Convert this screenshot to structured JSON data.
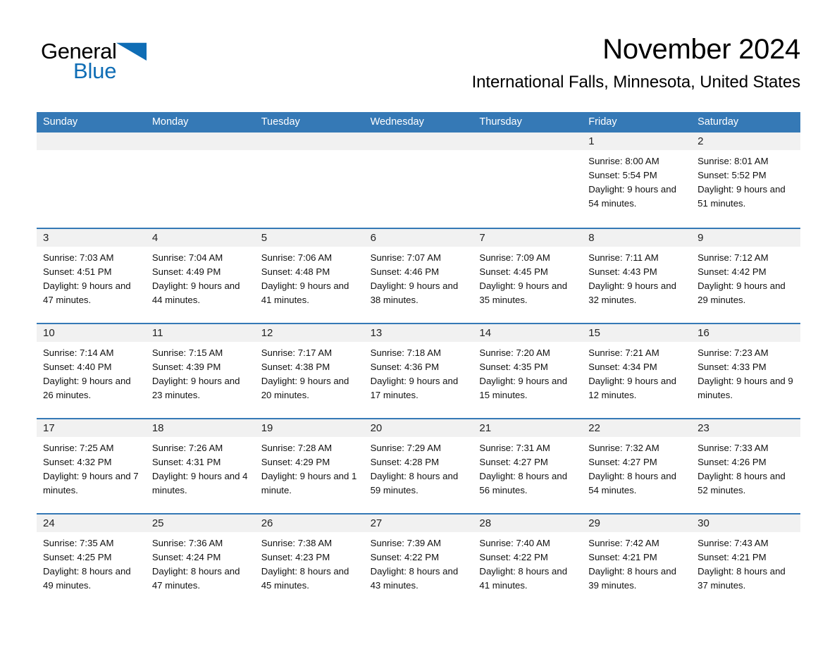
{
  "brand": {
    "name_part_1": "General",
    "name_part_2": "Blue",
    "triangle_color": "#0f6db5",
    "blue_text_color": "#0f6db5"
  },
  "header": {
    "month_title": "November 2024",
    "location": "International Falls, Minnesota, United States"
  },
  "colors": {
    "header_blue": "#3579b6",
    "row_divider_blue": "#3579b6",
    "day_band_gray": "#f1f1f1",
    "text_black": "#000000"
  },
  "weekdays": [
    "Sunday",
    "Monday",
    "Tuesday",
    "Wednesday",
    "Thursday",
    "Friday",
    "Saturday"
  ],
  "weeks": [
    [
      {
        "day": "",
        "sunrise": "",
        "sunset": "",
        "daylight": ""
      },
      {
        "day": "",
        "sunrise": "",
        "sunset": "",
        "daylight": ""
      },
      {
        "day": "",
        "sunrise": "",
        "sunset": "",
        "daylight": ""
      },
      {
        "day": "",
        "sunrise": "",
        "sunset": "",
        "daylight": ""
      },
      {
        "day": "",
        "sunrise": "",
        "sunset": "",
        "daylight": ""
      },
      {
        "day": "1",
        "sunrise": "Sunrise: 8:00 AM",
        "sunset": "Sunset: 5:54 PM",
        "daylight": "Daylight: 9 hours and 54 minutes."
      },
      {
        "day": "2",
        "sunrise": "Sunrise: 8:01 AM",
        "sunset": "Sunset: 5:52 PM",
        "daylight": "Daylight: 9 hours and 51 minutes."
      }
    ],
    [
      {
        "day": "3",
        "sunrise": "Sunrise: 7:03 AM",
        "sunset": "Sunset: 4:51 PM",
        "daylight": "Daylight: 9 hours and 47 minutes."
      },
      {
        "day": "4",
        "sunrise": "Sunrise: 7:04 AM",
        "sunset": "Sunset: 4:49 PM",
        "daylight": "Daylight: 9 hours and 44 minutes."
      },
      {
        "day": "5",
        "sunrise": "Sunrise: 7:06 AM",
        "sunset": "Sunset: 4:48 PM",
        "daylight": "Daylight: 9 hours and 41 minutes."
      },
      {
        "day": "6",
        "sunrise": "Sunrise: 7:07 AM",
        "sunset": "Sunset: 4:46 PM",
        "daylight": "Daylight: 9 hours and 38 minutes."
      },
      {
        "day": "7",
        "sunrise": "Sunrise: 7:09 AM",
        "sunset": "Sunset: 4:45 PM",
        "daylight": "Daylight: 9 hours and 35 minutes."
      },
      {
        "day": "8",
        "sunrise": "Sunrise: 7:11 AM",
        "sunset": "Sunset: 4:43 PM",
        "daylight": "Daylight: 9 hours and 32 minutes."
      },
      {
        "day": "9",
        "sunrise": "Sunrise: 7:12 AM",
        "sunset": "Sunset: 4:42 PM",
        "daylight": "Daylight: 9 hours and 29 minutes."
      }
    ],
    [
      {
        "day": "10",
        "sunrise": "Sunrise: 7:14 AM",
        "sunset": "Sunset: 4:40 PM",
        "daylight": "Daylight: 9 hours and 26 minutes."
      },
      {
        "day": "11",
        "sunrise": "Sunrise: 7:15 AM",
        "sunset": "Sunset: 4:39 PM",
        "daylight": "Daylight: 9 hours and 23 minutes."
      },
      {
        "day": "12",
        "sunrise": "Sunrise: 7:17 AM",
        "sunset": "Sunset: 4:38 PM",
        "daylight": "Daylight: 9 hours and 20 minutes."
      },
      {
        "day": "13",
        "sunrise": "Sunrise: 7:18 AM",
        "sunset": "Sunset: 4:36 PM",
        "daylight": "Daylight: 9 hours and 17 minutes."
      },
      {
        "day": "14",
        "sunrise": "Sunrise: 7:20 AM",
        "sunset": "Sunset: 4:35 PM",
        "daylight": "Daylight: 9 hours and 15 minutes."
      },
      {
        "day": "15",
        "sunrise": "Sunrise: 7:21 AM",
        "sunset": "Sunset: 4:34 PM",
        "daylight": "Daylight: 9 hours and 12 minutes."
      },
      {
        "day": "16",
        "sunrise": "Sunrise: 7:23 AM",
        "sunset": "Sunset: 4:33 PM",
        "daylight": "Daylight: 9 hours and 9 minutes."
      }
    ],
    [
      {
        "day": "17",
        "sunrise": "Sunrise: 7:25 AM",
        "sunset": "Sunset: 4:32 PM",
        "daylight": "Daylight: 9 hours and 7 minutes."
      },
      {
        "day": "18",
        "sunrise": "Sunrise: 7:26 AM",
        "sunset": "Sunset: 4:31 PM",
        "daylight": "Daylight: 9 hours and 4 minutes."
      },
      {
        "day": "19",
        "sunrise": "Sunrise: 7:28 AM",
        "sunset": "Sunset: 4:29 PM",
        "daylight": "Daylight: 9 hours and 1 minute."
      },
      {
        "day": "20",
        "sunrise": "Sunrise: 7:29 AM",
        "sunset": "Sunset: 4:28 PM",
        "daylight": "Daylight: 8 hours and 59 minutes."
      },
      {
        "day": "21",
        "sunrise": "Sunrise: 7:31 AM",
        "sunset": "Sunset: 4:27 PM",
        "daylight": "Daylight: 8 hours and 56 minutes."
      },
      {
        "day": "22",
        "sunrise": "Sunrise: 7:32 AM",
        "sunset": "Sunset: 4:27 PM",
        "daylight": "Daylight: 8 hours and 54 minutes."
      },
      {
        "day": "23",
        "sunrise": "Sunrise: 7:33 AM",
        "sunset": "Sunset: 4:26 PM",
        "daylight": "Daylight: 8 hours and 52 minutes."
      }
    ],
    [
      {
        "day": "24",
        "sunrise": "Sunrise: 7:35 AM",
        "sunset": "Sunset: 4:25 PM",
        "daylight": "Daylight: 8 hours and 49 minutes."
      },
      {
        "day": "25",
        "sunrise": "Sunrise: 7:36 AM",
        "sunset": "Sunset: 4:24 PM",
        "daylight": "Daylight: 8 hours and 47 minutes."
      },
      {
        "day": "26",
        "sunrise": "Sunrise: 7:38 AM",
        "sunset": "Sunset: 4:23 PM",
        "daylight": "Daylight: 8 hours and 45 minutes."
      },
      {
        "day": "27",
        "sunrise": "Sunrise: 7:39 AM",
        "sunset": "Sunset: 4:22 PM",
        "daylight": "Daylight: 8 hours and 43 minutes."
      },
      {
        "day": "28",
        "sunrise": "Sunrise: 7:40 AM",
        "sunset": "Sunset: 4:22 PM",
        "daylight": "Daylight: 8 hours and 41 minutes."
      },
      {
        "day": "29",
        "sunrise": "Sunrise: 7:42 AM",
        "sunset": "Sunset: 4:21 PM",
        "daylight": "Daylight: 8 hours and 39 minutes."
      },
      {
        "day": "30",
        "sunrise": "Sunrise: 7:43 AM",
        "sunset": "Sunset: 4:21 PM",
        "daylight": "Daylight: 8 hours and 37 minutes."
      }
    ]
  ]
}
